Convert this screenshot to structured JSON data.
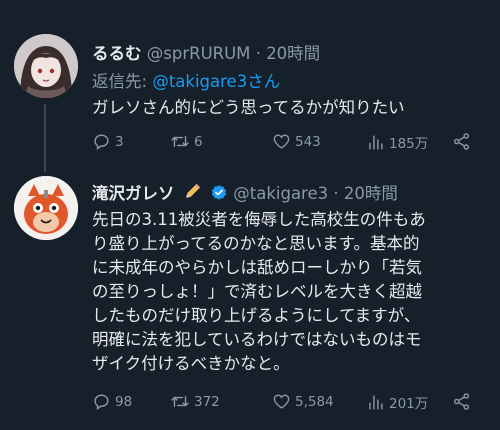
{
  "tweets": [
    {
      "display_name": "るるむ",
      "handle": "@sprRURUM",
      "separator": "·",
      "time": "20時間",
      "reply_prefix": "返信先: ",
      "reply_handle": "@takigare3",
      "reply_suffix": "さん",
      "lines": [
        "ガレソさん的にどう思ってるかが知りたい"
      ],
      "actions": {
        "replies": "3",
        "retweets": "6",
        "likes": "543",
        "views": "185万"
      }
    },
    {
      "display_name": "滝沢ガレソ",
      "handle": "@takigare3",
      "separator": "·",
      "time": "20時間",
      "verified": true,
      "lines": [
        "先日の3.11被災者を侮辱した高校生の件もあ",
        "り盛り上がってるのかなと思います。基本的",
        "に未成年のやらかしは舐めローしかり「若気",
        "の至りっしょ！」で済むレベルを大きく超越",
        "したものだけ取り上げるようにしてますが、",
        "明確に法を犯しているわけではないものはモ",
        "ザイク付けるべきかなと。"
      ],
      "actions": {
        "replies": "98",
        "retweets": "372",
        "likes": "5,584",
        "views": "201万"
      }
    }
  ],
  "colors": {
    "background": "#15202b",
    "text": "#e7e9ea",
    "secondary": "#8b98a5",
    "link": "#1d9bf0"
  }
}
